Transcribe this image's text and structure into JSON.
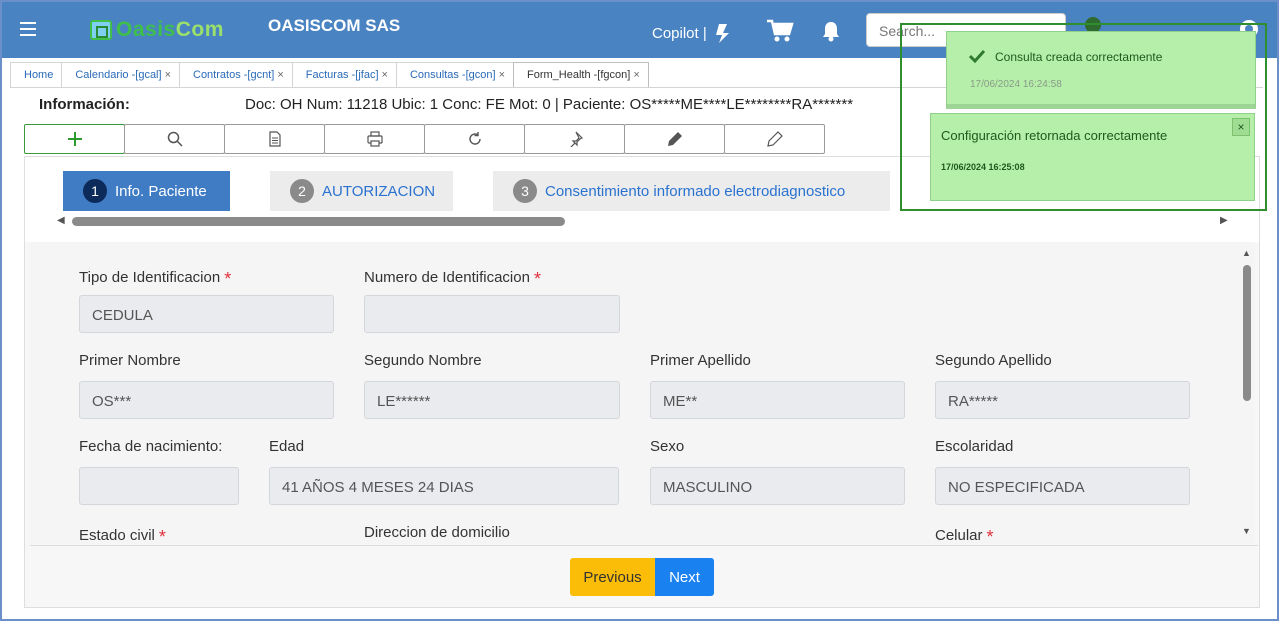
{
  "header": {
    "logo_text_a": "Oasis",
    "logo_text_b": "Com",
    "company": "OASISCOM SAS",
    "copilot_label": "Copilot |",
    "search_placeholder": "Search..."
  },
  "tabs": [
    {
      "label": "Home",
      "closable": false
    },
    {
      "label": "Calendario -[gcal]",
      "closable": true
    },
    {
      "label": "Contratos -[gcnt]",
      "closable": true
    },
    {
      "label": "Facturas -[jfac]",
      "closable": true
    },
    {
      "label": "Consultas -[gcon]",
      "closable": true
    },
    {
      "label": "Form_Health -[fgcon]",
      "closable": true,
      "active": true
    }
  ],
  "info": {
    "label": "Información:",
    "doc": "Doc: OH Num: 11218 Ubic: 1 Conc: FE Mot: 0 | Paciente: OS*****ME****LE********RA*******"
  },
  "steps": [
    {
      "num": "1",
      "label": "Info. Paciente"
    },
    {
      "num": "2",
      "label": "AUTORIZACION"
    },
    {
      "num": "3",
      "label": "Consentimiento informado electrodiagnostico"
    }
  ],
  "form": {
    "tipo_id": {
      "label": "Tipo de Identificacion",
      "value": "CEDULA"
    },
    "num_id": {
      "label": "Numero de Identificacion",
      "value": ""
    },
    "primer_nombre": {
      "label": "Primer Nombre",
      "value": "OS***"
    },
    "segundo_nombre": {
      "label": "Segundo Nombre",
      "value": "LE******"
    },
    "primer_apellido": {
      "label": "Primer Apellido",
      "value": "ME**"
    },
    "segundo_apellido": {
      "label": "Segundo Apellido",
      "value": "RA*****"
    },
    "fecha_nac": {
      "label": "Fecha de nacimiento:",
      "value": ""
    },
    "edad": {
      "label": "Edad",
      "value": "41 AÑOS 4 MESES 24 DIAS"
    },
    "sexo": {
      "label": "Sexo",
      "value": "MASCULINO"
    },
    "escolaridad": {
      "label": "Escolaridad",
      "value": "NO ESPECIFICADA"
    },
    "estado_civil": {
      "label": "Estado civil"
    },
    "direccion": {
      "label": "Direccion de domicilio"
    },
    "celular": {
      "label": "Celular"
    },
    "required_mark": "*"
  },
  "nav": {
    "previous": "Previous",
    "next": "Next"
  },
  "toasts": [
    {
      "message": "Consulta creada correctamente",
      "time": "17/06/2024 16:24:58"
    },
    {
      "message": "Configuración retornada correctamente",
      "time": "17/06/2024 16:25:08",
      "close": "×"
    }
  ],
  "colors": {
    "header_bg": "#4a83c2",
    "active_step": "#3f7cc4",
    "toast_bg": "#b6efa9",
    "prev_btn": "#fbbd08",
    "next_btn": "#1a82f0"
  }
}
